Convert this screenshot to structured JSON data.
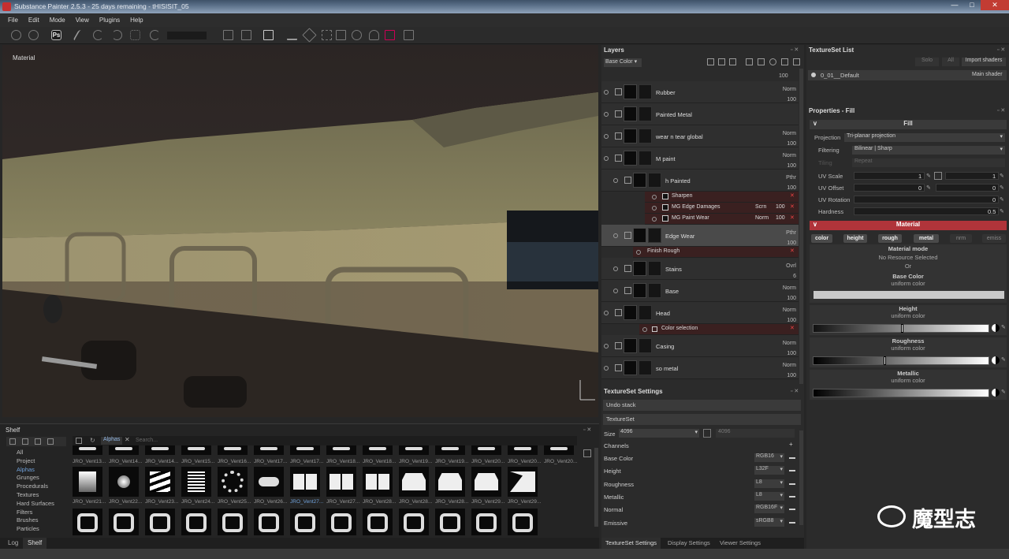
{
  "window": {
    "title": "Substance Painter 2.5.3 - 25 days remaining - tHISISIT_05",
    "minimize": "—",
    "maximize": "□",
    "close": "✕"
  },
  "menu": [
    "File",
    "Edit",
    "Mode",
    "View",
    "Plugins",
    "Help"
  ],
  "viewport": {
    "label": "Material"
  },
  "shelf": {
    "title": "Shelf",
    "categories": [
      "All",
      "Project",
      "Alphas",
      "Grunges",
      "Procedurals",
      "Textures",
      "Hard Surfaces",
      "Filters",
      "Brushes",
      "Particles"
    ],
    "filter_tag": "Alphas",
    "search_placeholder": "Search...",
    "row1": [
      "JRO_Vent13...",
      "JRO_Vent14...",
      "JRO_Vent14...",
      "JRO_Vent15...",
      "JRO_Vent16...",
      "JRO_Vent17...",
      "JRO_Vent17...",
      "JRO_Vent18...",
      "JRO_Vent18...",
      "JRO_Vent19...",
      "JRO_Vent19...",
      "JRO_Vent20...",
      "JRO_Vent20...",
      "JRO_Vent20..."
    ],
    "row2": [
      "JRO_Vent21...",
      "JRO_Vent22...",
      "JRO_Vent23...",
      "JRO_Vent24...",
      "JRO_Vent25...",
      "JRO_Vent26...",
      "JRO_Vent27...",
      "JRO_Vent27...",
      "JRO_Vent28...",
      "JRO_Vent28...",
      "JRO_Vent28...",
      "JRO_Vent29...",
      "JRO_Vent29..."
    ],
    "tabs": [
      "Log",
      "Shelf"
    ]
  },
  "layers": {
    "title": "Layers",
    "channel": "Base Color",
    "rows": [
      {
        "name": "Rubber",
        "blend": "Norm",
        "opacity": "100"
      },
      {
        "name": "Painted Metal",
        "blend": "",
        "opacity": ""
      },
      {
        "name": "wear n tear global",
        "blend": "Norm",
        "opacity": "100"
      },
      {
        "name": "M paint",
        "blend": "Norm",
        "opacity": "100"
      },
      {
        "name": "h Painted",
        "blend": "Pthr",
        "opacity": "100"
      },
      {
        "name": "Edge Wear",
        "blend": "Pthr",
        "opacity": "100"
      },
      {
        "name": "Stains",
        "blend": "Ovrl",
        "opacity": "6"
      },
      {
        "name": "Base",
        "blend": "Norm",
        "opacity": "100"
      },
      {
        "name": "Head",
        "blend": "Norm",
        "opacity": "100"
      },
      {
        "name": "Casing",
        "blend": "Norm",
        "opacity": "100"
      },
      {
        "name": "so metal",
        "blend": "Norm",
        "opacity": "100"
      }
    ],
    "filters": [
      {
        "name": "Sharpen",
        "blend": "",
        "opacity": ""
      },
      {
        "name": "MG Edge Damages",
        "blend": "Scrn",
        "opacity": "100"
      },
      {
        "name": "MG Paint Wear",
        "blend": "Norm",
        "opacity": "100"
      }
    ],
    "finish": "Finish Rough",
    "colorsel": "Color selection",
    "top_opacity": "100"
  },
  "texset_settings": {
    "title": "TextureSet Settings",
    "undo": "Undo stack",
    "tab": "TextureSet",
    "size_label": "Size",
    "size": "4096",
    "size2": "4096",
    "channels_label": "Channels",
    "channels": [
      {
        "name": "Base Color",
        "fmt": "RGB16"
      },
      {
        "name": "Height",
        "fmt": "L32F"
      },
      {
        "name": "Roughness",
        "fmt": "L8"
      },
      {
        "name": "Metallic",
        "fmt": "L8"
      },
      {
        "name": "Normal",
        "fmt": "RGB16F"
      },
      {
        "name": "Emissive",
        "fmt": "sRGB8"
      }
    ],
    "tabs": [
      "TextureSet Settings",
      "Display Settings",
      "Viewer Settings"
    ]
  },
  "texset_list": {
    "title": "TextureSet List",
    "btn_solo": "Solo",
    "btn_all": "All",
    "btn_import": "Import shaders",
    "item": "0_01__Default",
    "shader": "Main shader"
  },
  "properties": {
    "title": "Properties - Fill",
    "fill": "Fill",
    "projection_label": "Projection",
    "projection": "Tri-planar projection",
    "filtering_label": "Filtering",
    "filtering": "Bilinear | Sharp",
    "tiling_label": "Tiling",
    "tiling": "Repeat",
    "uvscale_label": "UV Scale",
    "uvscale": "1",
    "uvscale2": "1",
    "uvoffset_label": "UV Offset",
    "uvoffset": "0",
    "uvoffset2": "0",
    "uvrot_label": "UV Rotation",
    "uvrot": "0",
    "hardness_label": "Hardness",
    "hardness": "0.5",
    "material": "Material",
    "chips": [
      "color",
      "height",
      "rough",
      "metal",
      "nrm",
      "emiss"
    ],
    "mat_mode": "Material mode",
    "no_res": "No Resource Selected",
    "or": "Or",
    "base_color": "Base Color",
    "uniform": "uniform color",
    "height": "Height",
    "roughness": "Roughness",
    "metallic": "Metallic",
    "height_value": 0.5,
    "roughness_value": 0.4,
    "colors": {
      "accent": "#b0343a",
      "header_bg": "#3a3a3a"
    }
  },
  "watermark": "魔型志"
}
